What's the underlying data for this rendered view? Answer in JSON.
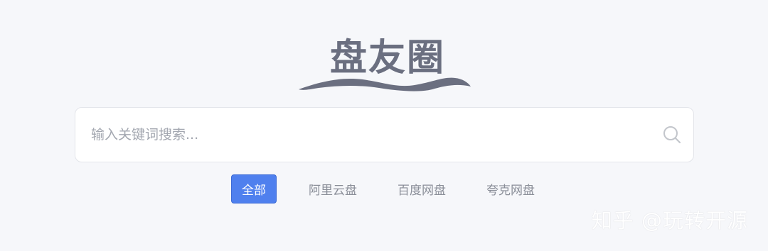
{
  "logo": {
    "text": "盘友圈"
  },
  "search": {
    "placeholder": "输入关键词搜索..."
  },
  "tabs": [
    {
      "label": "全部",
      "active": true
    },
    {
      "label": "阿里云盘",
      "active": false
    },
    {
      "label": "百度网盘",
      "active": false
    },
    {
      "label": "夸克网盘",
      "active": false
    }
  ],
  "watermark": {
    "text": "知乎 @玩转开源"
  },
  "colors": {
    "background": "#f6f7fa",
    "accent": "#4f80ee",
    "logo": "#6b6f80",
    "muted_text": "#8a8e98"
  },
  "icons": [
    "search-icon"
  ]
}
